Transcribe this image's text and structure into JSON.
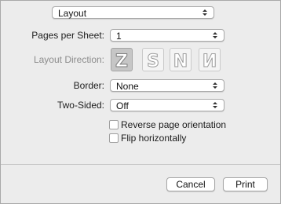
{
  "panel_select": {
    "value": "Layout"
  },
  "pages_per_sheet": {
    "label": "Pages per Sheet:",
    "value": "1"
  },
  "layout_direction": {
    "label": "Layout Direction:",
    "options": [
      "Z",
      "S",
      "N",
      "N"
    ],
    "selected_index": 0
  },
  "border": {
    "label": "Border:",
    "value": "None"
  },
  "two_sided": {
    "label": "Two-Sided:",
    "value": "Off"
  },
  "reverse_orientation": {
    "label": "Reverse page orientation",
    "checked": false
  },
  "flip_horizontal": {
    "label": "Flip horizontally",
    "checked": false
  },
  "buttons": {
    "cancel": "Cancel",
    "print": "Print"
  },
  "icons": {
    "popup_arrows": "up-down-arrows-icon"
  },
  "colors": {
    "selected_direction_bg": "#c6c6c6",
    "dim_label": "#8c8c8c"
  }
}
